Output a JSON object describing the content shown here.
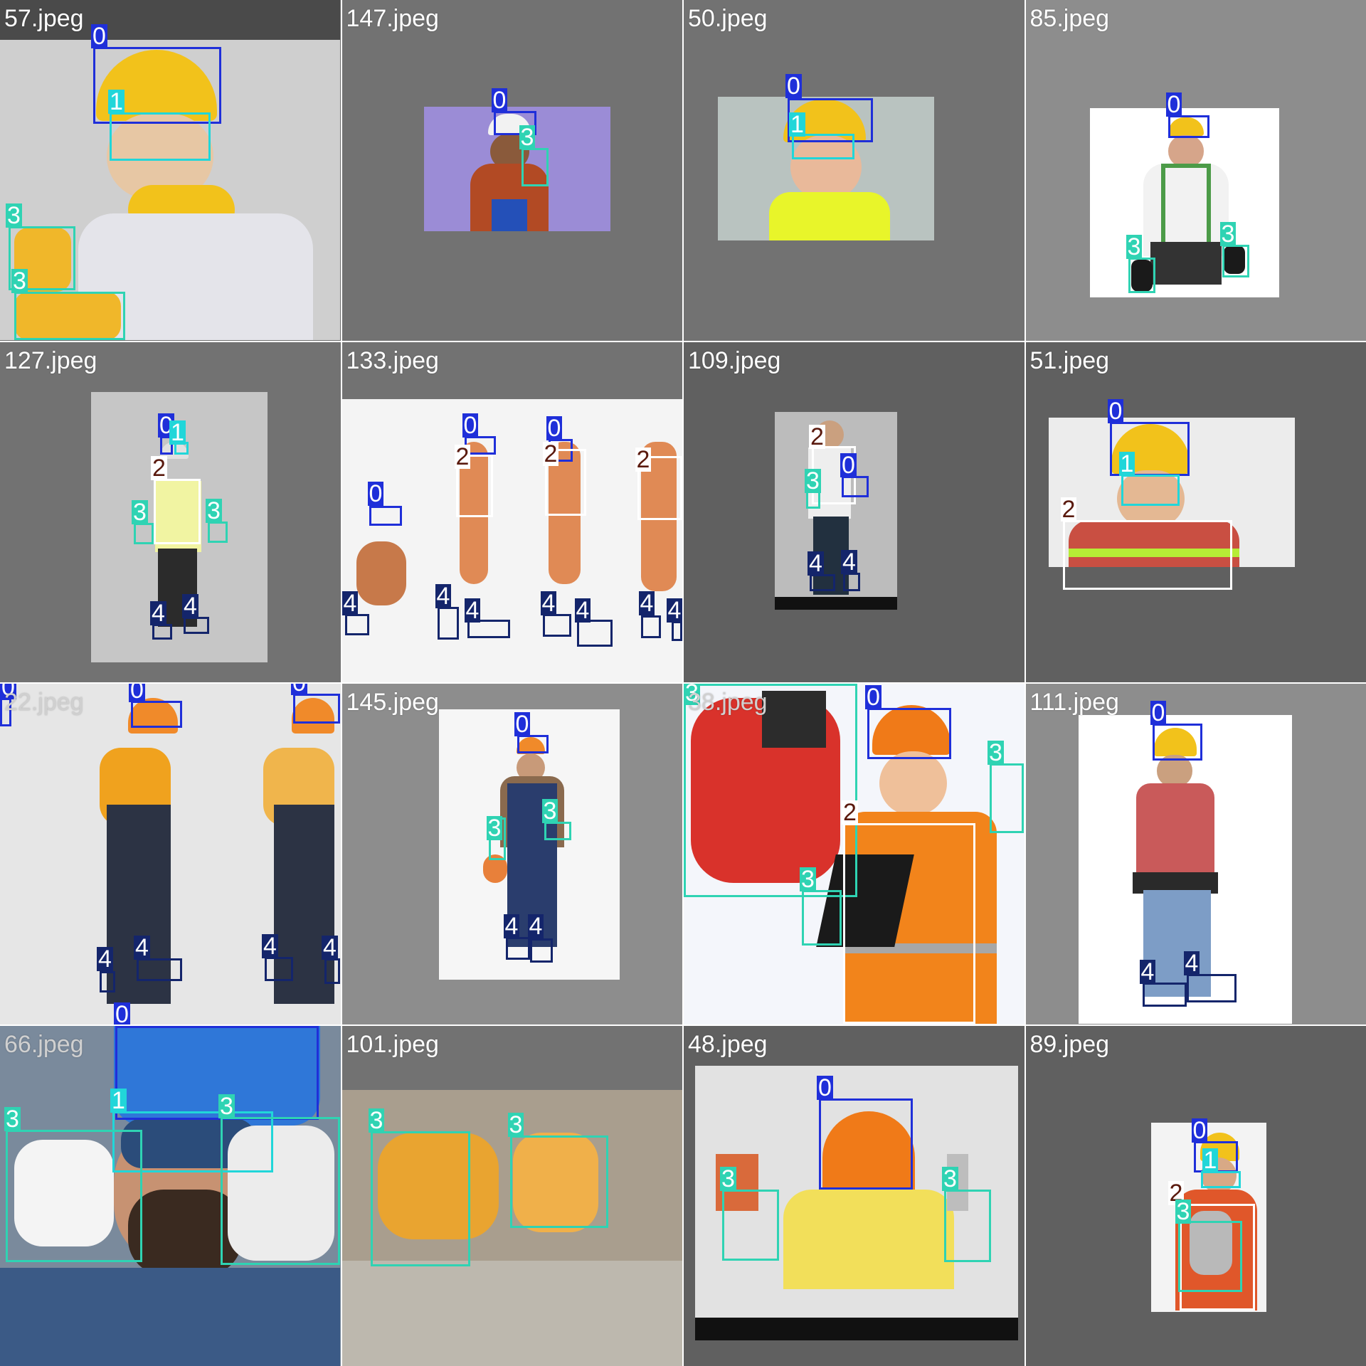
{
  "title": "",
  "palette": {
    "c0": "#1f2fd9",
    "c1": "#21d6d9",
    "c2": "#ffffff",
    "c3": "#2fd3b3",
    "c4": "#14256b",
    "lbl2_bg": "#ffffff",
    "lbl2_fg": "#5a1a0e"
  },
  "tiles": [
    {
      "filename": "57.jpeg",
      "bg": "#6e6e6e",
      "photo": "#cfcfcf",
      "labels": [
        "0",
        "1",
        "3",
        "3"
      ]
    },
    {
      "filename": "147.jpeg",
      "bg": "#727272",
      "photo": "#9b8cd6",
      "labels": [
        "0",
        "3"
      ]
    },
    {
      "filename": "50.jpeg",
      "bg": "#727272",
      "photo": "#b9c3c0",
      "labels": [
        "0",
        "1"
      ]
    },
    {
      "filename": "85.jpeg",
      "bg": "#8d8d8d",
      "photo": "#ffffff",
      "labels": [
        "0",
        "3",
        "3"
      ]
    },
    {
      "filename": "127.jpeg",
      "bg": "#727272",
      "photo": "#c6c6c6",
      "labels": [
        "0",
        "1",
        "2",
        "3",
        "3",
        "4",
        "4"
      ]
    },
    {
      "filename": "133.jpeg",
      "bg": "#727272",
      "photo": "#f4f4f4",
      "labels": [
        "0",
        "0",
        "0",
        "2",
        "2",
        "2",
        "4",
        "4",
        "4",
        "4",
        "4",
        "4",
        "4"
      ]
    },
    {
      "filename": "109.jpeg",
      "bg": "#606060",
      "photo": "#bcbcbc",
      "labels": [
        "2",
        "0",
        "3",
        "4",
        "4"
      ]
    },
    {
      "filename": "51.jpeg",
      "bg": "#606060",
      "photo": "#ececec",
      "labels": [
        "0",
        "1",
        "2"
      ]
    },
    {
      "filename": "22.jpeg",
      "bg": "#e6e6e6",
      "photo": "#e6e6e6",
      "labels": [
        "0",
        "0",
        "0",
        "4",
        "4",
        "4",
        "4",
        "0"
      ]
    },
    {
      "filename": "145.jpeg",
      "bg": "#8d8d8d",
      "photo": "#f6f6f6",
      "labels": [
        "0",
        "3",
        "3",
        "4",
        "4"
      ]
    },
    {
      "filename": "38.jpeg",
      "bg": "#f4f6fb",
      "photo": "#f4f6fb",
      "labels": [
        "3",
        "0",
        "3",
        "2",
        "3"
      ]
    },
    {
      "filename": "111.jpeg",
      "bg": "#8d8d8d",
      "photo": "#ffffff",
      "labels": [
        "0",
        "4",
        "4"
      ]
    },
    {
      "filename": "66.jpeg",
      "bg": "#7a8a9c",
      "photo": "#7a8a9c",
      "labels": [
        "1",
        "3",
        "3"
      ]
    },
    {
      "filename": "101.jpeg",
      "bg": "#727272",
      "photo": "#a99e8e",
      "labels": [
        "3",
        "3"
      ]
    },
    {
      "filename": "48.jpeg",
      "bg": "#606060",
      "photo": "#e2e2e2",
      "labels": [
        "0",
        "3",
        "3"
      ]
    },
    {
      "filename": "89.jpeg",
      "bg": "#606060",
      "photo": "#f3f3f3",
      "labels": [
        "0",
        "1",
        "2",
        "3"
      ]
    }
  ]
}
